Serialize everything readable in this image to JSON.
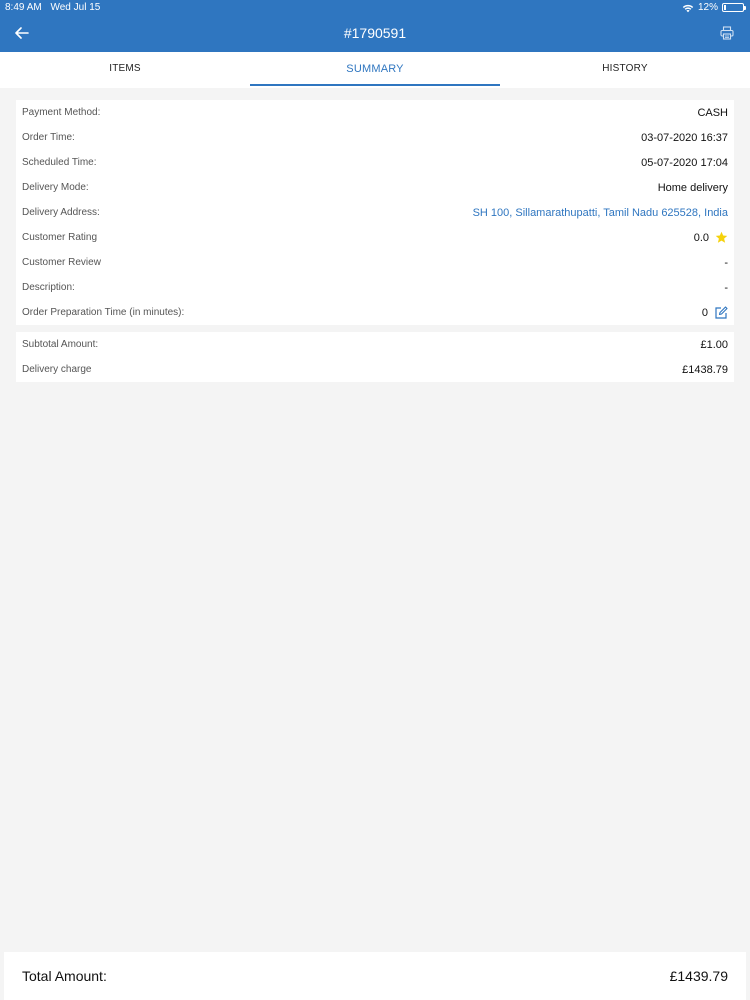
{
  "status_bar": {
    "time": "8:49 AM",
    "date": "Wed Jul 15",
    "battery": "12%",
    "battery_level": 0.12
  },
  "header": {
    "title": "#1790591",
    "back_icon": "arrow-left-icon",
    "print_icon": "printer-icon"
  },
  "tabs": [
    {
      "label": "ITEMS",
      "active": false
    },
    {
      "label": "SUMMARY",
      "active": true
    },
    {
      "label": "HISTORY",
      "active": false
    }
  ],
  "details": {
    "payment_method": {
      "label": "Payment Method:",
      "value": "CASH"
    },
    "order_time": {
      "label": "Order Time:",
      "value": "03-07-2020 16:37"
    },
    "scheduled_time": {
      "label": "Scheduled Time:",
      "value": "05-07-2020 17:04"
    },
    "delivery_mode": {
      "label": "Delivery Mode:",
      "value": "Home delivery"
    },
    "delivery_address": {
      "label": "Delivery Address:",
      "value": "SH 100, Sillamarathupatti, Tamil Nadu 625528, India"
    },
    "customer_rating": {
      "label": "Customer Rating",
      "value": "0.0"
    },
    "customer_review": {
      "label": "Customer Review",
      "value": "-"
    },
    "description": {
      "label": "Description:",
      "value": "-"
    },
    "prep_time": {
      "label": "Order Preparation Time (in minutes):",
      "value": "0"
    }
  },
  "amounts": {
    "subtotal": {
      "label": "Subtotal Amount:",
      "value": "£1.00"
    },
    "delivery_charge": {
      "label": "Delivery charge",
      "value": "£1438.79"
    }
  },
  "footer": {
    "total_label": "Total Amount:",
    "total_value": "£1439.79"
  },
  "colors": {
    "primary": "#2f76c0",
    "star": "#f5d20c",
    "background": "#f4f4f4"
  }
}
